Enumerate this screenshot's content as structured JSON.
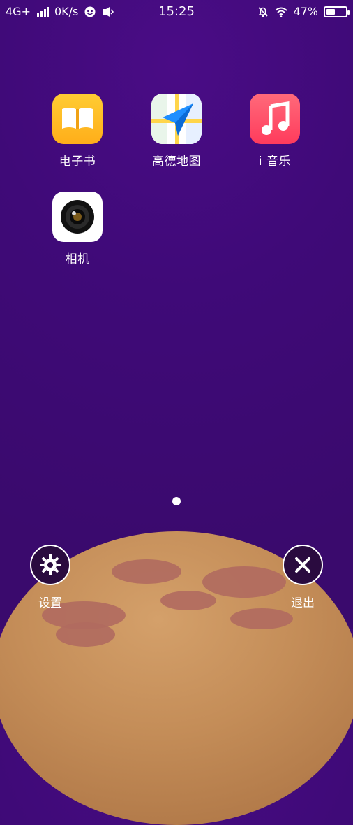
{
  "status_bar": {
    "network": "4G+",
    "speed": "0K/s",
    "time": "15:25",
    "battery_text": "47%",
    "battery_level": 0.47
  },
  "apps": [
    {
      "label": "电子书",
      "icon": "book-icon"
    },
    {
      "label": "高德地图",
      "icon": "map-navigation-icon"
    },
    {
      "label": "i 音乐",
      "icon": "music-note-icon"
    },
    {
      "label": "相机",
      "icon": "camera-lens-icon"
    }
  ],
  "page_indicator": {
    "current": 1,
    "total": 1
  },
  "bottom": {
    "settings_label": "设置",
    "exit_label": "退出"
  },
  "colors": {
    "background": "#3f0a78",
    "planet": "#c48d58",
    "ebook": "#ffb81f",
    "music": "#ff4b68"
  }
}
